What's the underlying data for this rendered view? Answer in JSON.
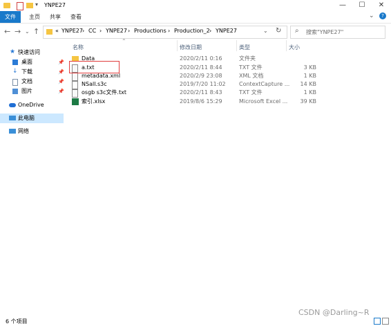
{
  "window": {
    "title": "YNPE27",
    "minimize": "—",
    "maximize": "☐",
    "close": "✕"
  },
  "ribbon": {
    "tabs": [
      "文件",
      "主页",
      "共享",
      "查看"
    ]
  },
  "address": {
    "crumbs": [
      "«",
      "YNPE27",
      "›",
      "CC",
      "›",
      "YNPE27",
      "›",
      "Productions",
      "›",
      "Production_2",
      "›",
      "YNPE27"
    ],
    "search_placeholder": "搜索\"YNPE27\""
  },
  "sidebar": {
    "items": [
      {
        "label": "快速访问",
        "icon": "star-icon",
        "color": "#2b7bd6"
      },
      {
        "label": "桌面",
        "icon": "desktop-icon",
        "color": "#2b7bd6",
        "pinned": true
      },
      {
        "label": "下载",
        "icon": "download-icon",
        "color": "#2b7bd6",
        "pinned": true
      },
      {
        "label": "文档",
        "icon": "document-icon",
        "color": "#7a8fa6",
        "pinned": true
      },
      {
        "label": "图片",
        "icon": "pictures-icon",
        "color": "#4f8fd6",
        "pinned": true
      },
      {
        "label": "OneDrive",
        "icon": "cloud-icon",
        "color": "#1f6ed4"
      },
      {
        "label": "此电脑",
        "icon": "computer-icon",
        "color": "#3a8fd8",
        "selected": true
      },
      {
        "label": "网络",
        "icon": "network-icon",
        "color": "#3a8fd8"
      }
    ]
  },
  "columns": {
    "name": "名称",
    "date": "修改日期",
    "type": "类型",
    "size": "大小"
  },
  "files": [
    {
      "name": "Data",
      "date": "2020/2/11 0:16",
      "type": "文件夹",
      "size": "",
      "icon": "folder-icon"
    },
    {
      "name": "a.txt",
      "date": "2020/2/11 8:44",
      "type": "TXT 文件",
      "size": "3 KB",
      "icon": "text-file-icon",
      "highlighted": true
    },
    {
      "name": "metadata.xml",
      "date": "2020/2/9 23:08",
      "type": "XML 文档",
      "size": "1 KB",
      "icon": "xml-file-icon"
    },
    {
      "name": "NSall.s3c",
      "date": "2019/7/20 11:02",
      "type": "ContextCapture ...",
      "size": "14 KB",
      "icon": "file-icon"
    },
    {
      "name": "osgb s3c文件.txt",
      "date": "2020/2/11 8:43",
      "type": "TXT 文件",
      "size": "1 KB",
      "icon": "text-file-icon"
    },
    {
      "name": "索引.xlsx",
      "date": "2019/8/6 15:29",
      "type": "Microsoft Excel ...",
      "size": "39 KB",
      "icon": "excel-file-icon"
    }
  ],
  "status": {
    "count": "6 个项目"
  },
  "watermark": "CSDN @Darling~R",
  "colors": {
    "accent": "#1979ca",
    "highlight_box": "#e03c3c",
    "folder": "#f5c542"
  }
}
